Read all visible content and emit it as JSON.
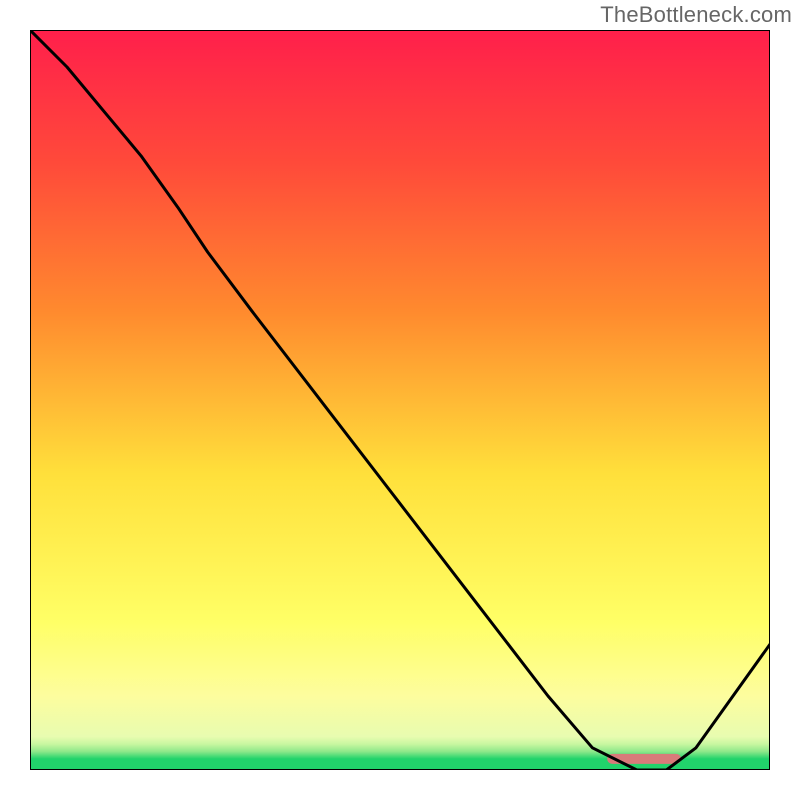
{
  "watermark": "TheBottleneck.com",
  "chart_data": {
    "type": "line",
    "title": "",
    "xlabel": "",
    "ylabel": "",
    "xlim": [
      0,
      100
    ],
    "ylim": [
      0,
      100
    ],
    "series": [
      {
        "name": "curve",
        "x": [
          0,
          5,
          10,
          15,
          20,
          24,
          30,
          40,
          50,
          60,
          70,
          76,
          82,
          86,
          90,
          100
        ],
        "y": [
          100,
          95,
          89,
          83,
          76,
          70,
          62,
          49,
          36,
          23,
          10,
          3,
          0,
          0,
          3,
          17
        ]
      }
    ],
    "marker": {
      "name": "optimal-range",
      "x_start": 78,
      "x_end": 88,
      "y": 1.5,
      "color": "#d97a7a"
    },
    "background_gradient": {
      "top_color": "#ff1f4b",
      "mid_upper_color": "#ff8a2e",
      "mid_color": "#ffe03b",
      "lower_color": "#fdfd9e",
      "bottom_band_color": "#21d36b"
    }
  }
}
